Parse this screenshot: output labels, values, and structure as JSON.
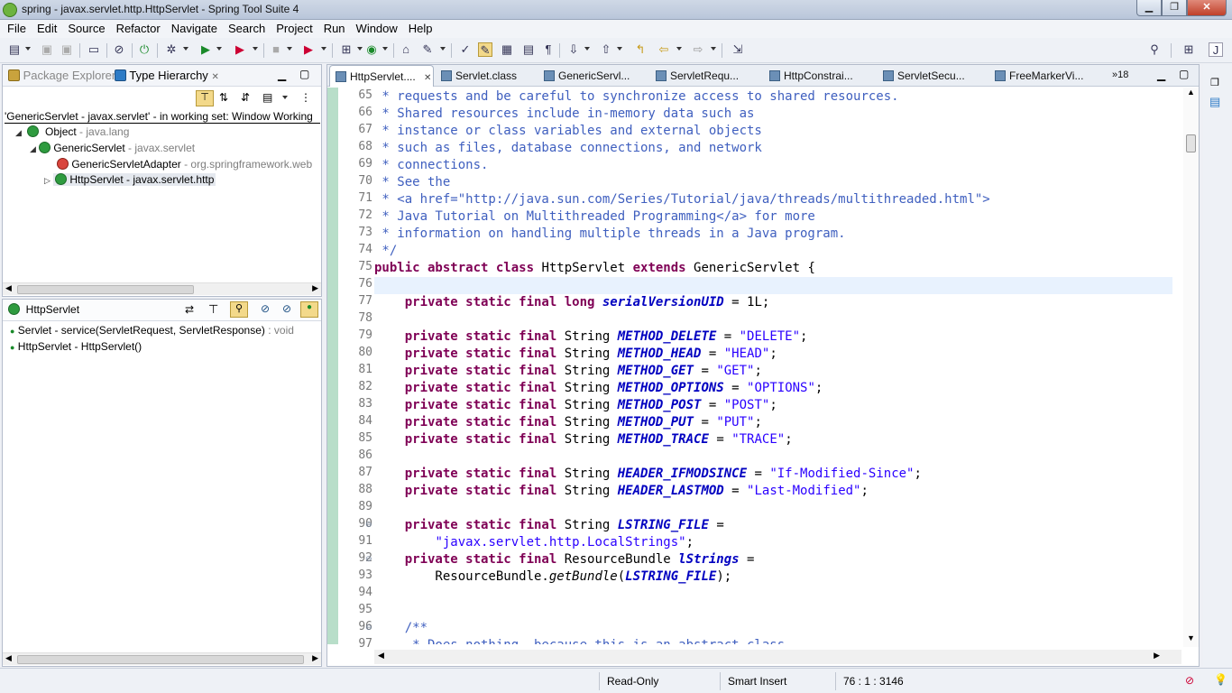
{
  "window": {
    "title": "spring - javax.servlet.http.HttpServlet - Spring Tool Suite 4",
    "min": "▁",
    "max": "❐",
    "close": "✕"
  },
  "menu": [
    "File",
    "Edit",
    "Source",
    "Refactor",
    "Navigate",
    "Search",
    "Project",
    "Run",
    "Window",
    "Help"
  ],
  "left_top": {
    "tab_package_explorer": "Package Explorer",
    "tab_type_hierarchy": "Type Hierarchy",
    "tab_close": "✕",
    "working_set": "'GenericServlet - javax.servlet' - in working set: Window Working",
    "tree": [
      {
        "name": "Object",
        "pkg": " - java.lang"
      },
      {
        "name": "GenericServlet",
        "pkg": " - javax.servlet"
      },
      {
        "name": "GenericServletAdapter",
        "pkg": " - org.springframework.web"
      },
      {
        "name": "HttpServlet - javax.servlet.http",
        "pkg": ""
      }
    ]
  },
  "left_bottom": {
    "type_name": "HttpServlet",
    "members": [
      {
        "name": "Servlet - service(ServletRequest, ServletResponse)",
        "ret": " : void"
      },
      {
        "name": "HttpServlet - HttpServlet()",
        "ret": ""
      }
    ]
  },
  "editor_tabs": [
    "HttpServlet....",
    "Servlet.class",
    "GenericServl...",
    "ServletRequ...",
    "HttpConstrai...",
    "ServletSecu...",
    "FreeMarkerVi..."
  ],
  "editor_overflow": "»18",
  "code": {
    "lines": [
      {
        "n": "65",
        "parts": [
          [
            "cm",
            " * requests and be careful to synchronize access to shared resources."
          ]
        ]
      },
      {
        "n": "66",
        "parts": [
          [
            "cm",
            " * Shared resources include in-memory data such as"
          ]
        ]
      },
      {
        "n": "67",
        "parts": [
          [
            "cm",
            " * instance or class variables and external objects"
          ]
        ]
      },
      {
        "n": "68",
        "parts": [
          [
            "cm",
            " * such as files, database connections, and network"
          ]
        ]
      },
      {
        "n": "69",
        "parts": [
          [
            "cm",
            " * connections."
          ]
        ]
      },
      {
        "n": "70",
        "parts": [
          [
            "cm",
            " * See the"
          ]
        ]
      },
      {
        "n": "71",
        "parts": [
          [
            "cm",
            " * <a href=\"http://java.sun.com/Series/Tutorial/java/threads/multithreaded.html\">"
          ]
        ]
      },
      {
        "n": "72",
        "parts": [
          [
            "cm",
            " * Java Tutorial on Multithreaded Programming</a> for more"
          ]
        ]
      },
      {
        "n": "73",
        "parts": [
          [
            "cm",
            " * information on handling multiple threads in a Java program."
          ]
        ]
      },
      {
        "n": "74",
        "parts": [
          [
            "cm",
            " */"
          ]
        ]
      },
      {
        "n": "75",
        "parts": [
          [
            "kw",
            "public abstract class"
          ],
          [
            "",
            "HttpServlet "
          ],
          [
            "kw",
            "extends"
          ],
          [
            "",
            " GenericServlet {"
          ]
        ]
      },
      {
        "n": "76",
        "parts": [
          [
            "",
            ""
          ]
        ],
        "current": true
      },
      {
        "n": "77",
        "parts": [
          [
            "",
            "    "
          ],
          [
            "kw",
            "private static final long"
          ],
          [
            "",
            " "
          ],
          [
            "fs",
            "serialVersionUID"
          ],
          [
            "",
            " = 1L;"
          ]
        ]
      },
      {
        "n": "78",
        "parts": [
          [
            "",
            ""
          ]
        ]
      },
      {
        "n": "79",
        "parts": [
          [
            "",
            "    "
          ],
          [
            "kw",
            "private static final"
          ],
          [
            "",
            " String "
          ],
          [
            "fs",
            "METHOD_DELETE"
          ],
          [
            "",
            " = "
          ],
          [
            "st",
            "\"DELETE\""
          ],
          [
            "",
            ";"
          ]
        ]
      },
      {
        "n": "80",
        "parts": [
          [
            "",
            "    "
          ],
          [
            "kw",
            "private static final"
          ],
          [
            "",
            " String "
          ],
          [
            "fs",
            "METHOD_HEAD"
          ],
          [
            "",
            " = "
          ],
          [
            "st",
            "\"HEAD\""
          ],
          [
            "",
            ";"
          ]
        ]
      },
      {
        "n": "81",
        "parts": [
          [
            "",
            "    "
          ],
          [
            "kw",
            "private static final"
          ],
          [
            "",
            " String "
          ],
          [
            "fs",
            "METHOD_GET"
          ],
          [
            "",
            " = "
          ],
          [
            "st",
            "\"GET\""
          ],
          [
            "",
            ";"
          ]
        ]
      },
      {
        "n": "82",
        "parts": [
          [
            "",
            "    "
          ],
          [
            "kw",
            "private static final"
          ],
          [
            "",
            " String "
          ],
          [
            "fs",
            "METHOD_OPTIONS"
          ],
          [
            "",
            " = "
          ],
          [
            "st",
            "\"OPTIONS\""
          ],
          [
            "",
            ";"
          ]
        ]
      },
      {
        "n": "83",
        "parts": [
          [
            "",
            "    "
          ],
          [
            "kw",
            "private static final"
          ],
          [
            "",
            " String "
          ],
          [
            "fs",
            "METHOD_POST"
          ],
          [
            "",
            " = "
          ],
          [
            "st",
            "\"POST\""
          ],
          [
            "",
            ";"
          ]
        ]
      },
      {
        "n": "84",
        "parts": [
          [
            "",
            "    "
          ],
          [
            "kw",
            "private static final"
          ],
          [
            "",
            " String "
          ],
          [
            "fs",
            "METHOD_PUT"
          ],
          [
            "",
            " = "
          ],
          [
            "st",
            "\"PUT\""
          ],
          [
            "",
            ";"
          ]
        ]
      },
      {
        "n": "85",
        "parts": [
          [
            "",
            "    "
          ],
          [
            "kw",
            "private static final"
          ],
          [
            "",
            " String "
          ],
          [
            "fs",
            "METHOD_TRACE"
          ],
          [
            "",
            " = "
          ],
          [
            "st",
            "\"TRACE\""
          ],
          [
            "",
            ";"
          ]
        ]
      },
      {
        "n": "86",
        "parts": [
          [
            "",
            ""
          ]
        ]
      },
      {
        "n": "87",
        "parts": [
          [
            "",
            "    "
          ],
          [
            "kw",
            "private static final"
          ],
          [
            "",
            " String "
          ],
          [
            "fs",
            "HEADER_IFMODSINCE"
          ],
          [
            "",
            " = "
          ],
          [
            "st",
            "\"If-Modified-Since\""
          ],
          [
            "",
            ";"
          ]
        ]
      },
      {
        "n": "88",
        "parts": [
          [
            "",
            "    "
          ],
          [
            "kw",
            "private static final"
          ],
          [
            "",
            " String "
          ],
          [
            "fs",
            "HEADER_LASTMOD"
          ],
          [
            "",
            " = "
          ],
          [
            "st",
            "\"Last-Modified\""
          ],
          [
            "",
            ";"
          ]
        ]
      },
      {
        "n": "89",
        "parts": [
          [
            "",
            ""
          ]
        ]
      },
      {
        "n": "90",
        "fold": true,
        "parts": [
          [
            "",
            "    "
          ],
          [
            "kw",
            "private static final"
          ],
          [
            "",
            " String "
          ],
          [
            "fs",
            "LSTRING_FILE"
          ],
          [
            "",
            " ="
          ]
        ]
      },
      {
        "n": "91",
        "parts": [
          [
            "",
            "        "
          ],
          [
            "st",
            "\"javax.servlet.http.LocalStrings\""
          ],
          [
            "",
            ";"
          ]
        ]
      },
      {
        "n": "92",
        "fold": true,
        "parts": [
          [
            "",
            "    "
          ],
          [
            "kw",
            "private static final"
          ],
          [
            "",
            " ResourceBundle "
          ],
          [
            "fs",
            "lStrings"
          ],
          [
            "",
            " ="
          ]
        ]
      },
      {
        "n": "93",
        "parts": [
          [
            "",
            "        ResourceBundle."
          ],
          [
            "it",
            "getBundle"
          ],
          [
            "",
            "("
          ],
          [
            "fs",
            "LSTRING_FILE"
          ],
          [
            "",
            ");"
          ]
        ]
      },
      {
        "n": "94",
        "parts": [
          [
            "",
            ""
          ]
        ]
      },
      {
        "n": "95",
        "parts": [
          [
            "",
            ""
          ]
        ]
      },
      {
        "n": "96",
        "fold": true,
        "parts": [
          [
            "",
            "    "
          ],
          [
            "cm",
            "/**"
          ]
        ]
      },
      {
        "n": "97",
        "parts": [
          [
            "cm",
            "     * Does nothing, because this is an abstract class."
          ]
        ]
      }
    ]
  },
  "status": {
    "mode": "Read-Only",
    "insert": "Smart Insert",
    "position": "76 : 1 : 3146"
  },
  "colors": {
    "comment": "#3f5fbf",
    "keyword": "#7f0055",
    "field": "#0000c0",
    "string": "#2a00ff",
    "current_line": "#e8f2fe",
    "ruler": "#b8dec9"
  }
}
